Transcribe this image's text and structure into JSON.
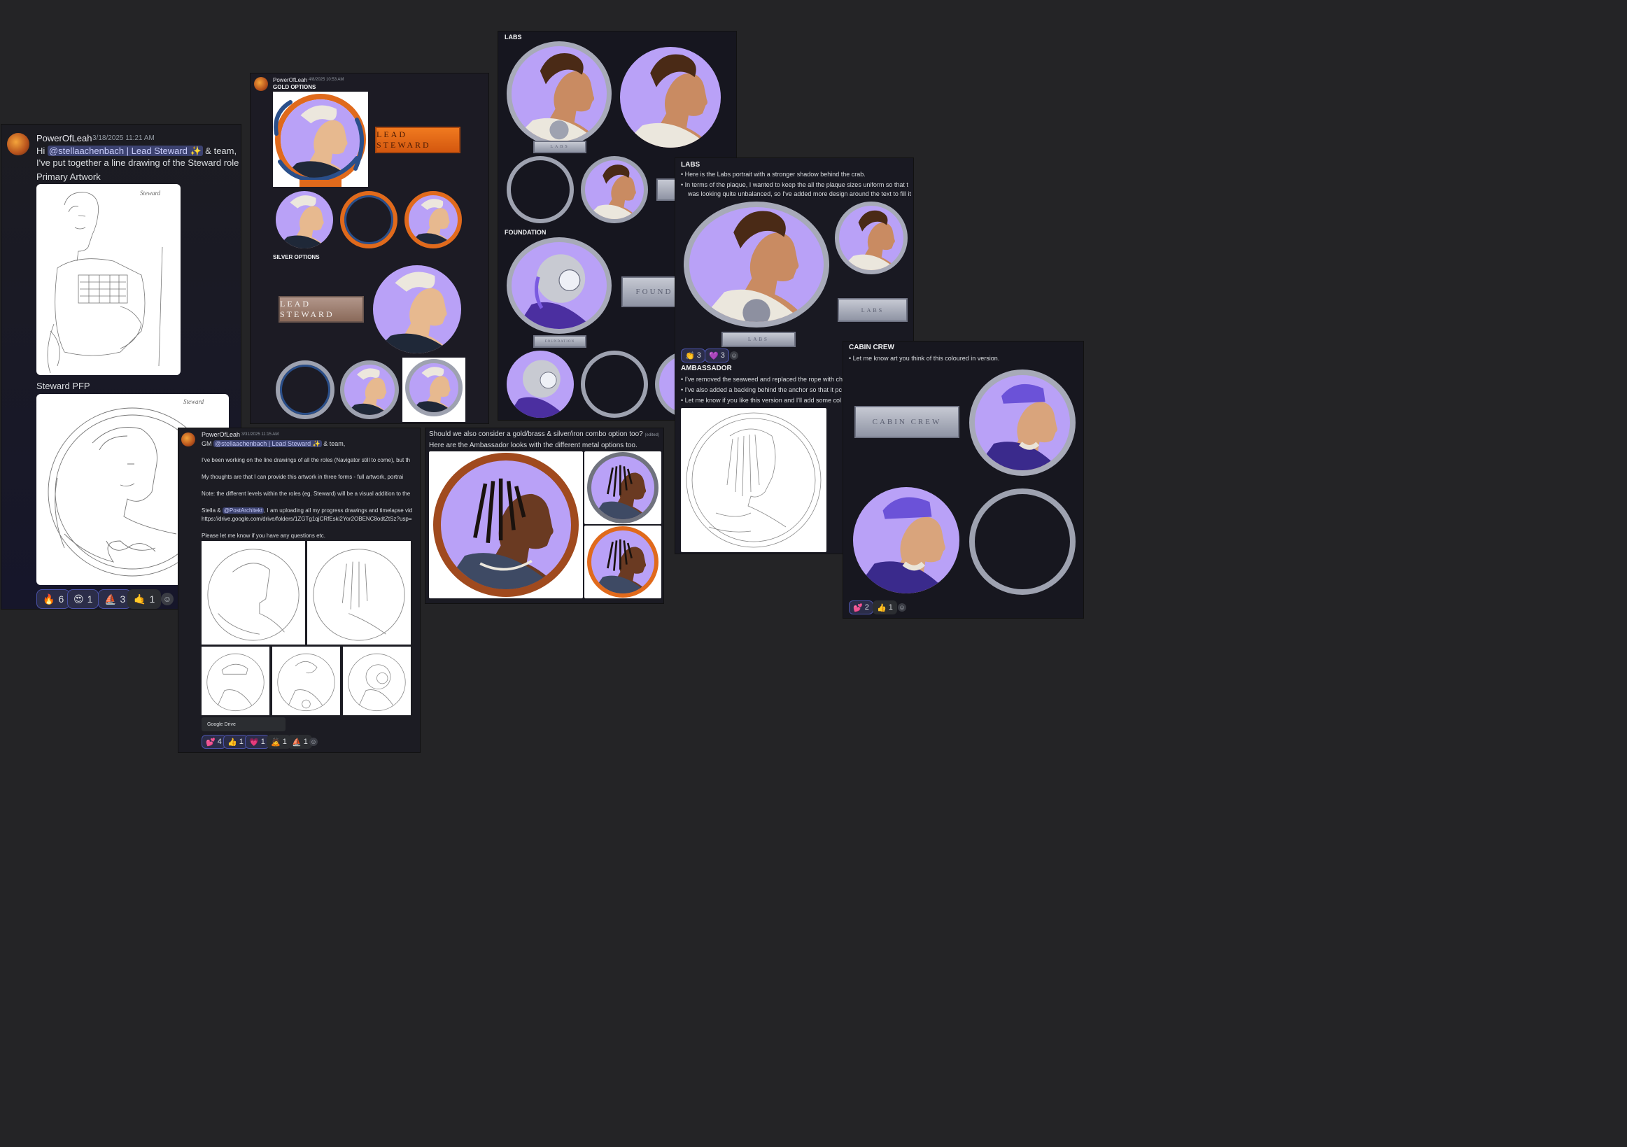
{
  "panel1": {
    "author": "PowerOfLeah",
    "timestamp": "3/18/2025 11:21 AM",
    "greeting": "Hi",
    "mention": "@stellaachenbach | Lead Steward ✨",
    "greeting_tail": " & team,",
    "body": "I've put together a line drawing of the Steward role (Prir",
    "label_primary": "Primary Artwork",
    "label_pfp": "Steward PFP",
    "sketch_signature": "Steward",
    "reactions": [
      {
        "emoji": "🔥",
        "count": "6"
      },
      {
        "emoji": "😍",
        "count": "1"
      },
      {
        "emoji": "⛵",
        "count": "3"
      },
      {
        "emoji": "🤙",
        "count": "1"
      }
    ]
  },
  "panel2": {
    "author": "PowerOfLeah",
    "timestamp": "4/8/2025 10:53 AM",
    "gold_heading": "GOLD OPTIONS",
    "silver_heading": "SILVER OPTIONS",
    "plaque_text": "LEAD STEWARD"
  },
  "panel3": {
    "labs_heading": "LABS",
    "foundation_heading": "FOUNDATION",
    "labs_plaque": "LABS",
    "foundation_plaque": "FOUNDATION",
    "foundation_plaque_partial": "FOUND"
  },
  "panel4": {
    "labs_heading": "LABS",
    "bullets": [
      "Here is the Labs portrait with a stronger shadow behind the crab.",
      "In terms of the plaque, I wanted to keep the all the plaque sizes uniform so that t",
      "was looking quite unbalanced, so I've added more design around the text to fill it"
    ],
    "plaque_small": "LABS",
    "plaque_bottom": "LABS",
    "reactions": [
      {
        "emoji": "👏",
        "count": "3"
      },
      {
        "emoji": "💜",
        "count": "3"
      }
    ],
    "ambassador_heading": "AMBASSADOR",
    "ambassador_bullets": [
      "I've removed the seaweed and replaced the rope with ch",
      "I've also added a backing behind the anchor so that it pc",
      "Let me know if you like this version and I'll add some col"
    ]
  },
  "panel5": {
    "heading": "CABIN CREW",
    "bullet": "Let me know art you think of this coloured in version.",
    "plaque": "CABIN CREW",
    "reactions": [
      {
        "emoji": "💕",
        "count": "2"
      },
      {
        "emoji": "👍",
        "count": "1"
      }
    ]
  },
  "panel6": {
    "author": "PowerOfLeah",
    "timestamp": "3/31/2025 11:15 AM",
    "greeting": "GM",
    "mention": "@stellaachenbach | Lead Steward ✨",
    "greeting_tail": " & team,",
    "p1": "I've been working on the line drawings of all the roles (Navigator still to come), but th",
    "p2": "My thoughts are that I can provide this artwork in three forms - full artwork, portrai",
    "p3": "Note: the different levels within the roles (eg. Steward) will be a visual addition to the",
    "p4_pre": "Stella &",
    "p4_mention": "@PostArchitekt",
    "p4_post": ", I am uploading all my progress drawings and timelapse vid",
    "link": "https://drive.google.com/drive/folders/1ZGTg1qjCRfEski2Yor2OBENC8odtZtSz?usp=",
    "p5": "Please let me know if you have any questions etc.",
    "embed_label": "Google Drive",
    "reactions": [
      {
        "emoji": "💕",
        "count": "4"
      },
      {
        "emoji": "👍",
        "count": "1"
      },
      {
        "emoji": "💗",
        "count": "1"
      },
      {
        "emoji": "🙇",
        "count": "1"
      },
      {
        "emoji": "⛵",
        "count": "1"
      }
    ]
  },
  "panel7": {
    "question": "Should we also consider a gold/brass & silver/iron combo option too?",
    "edited": "(edited)",
    "body": "Here are the Ambassador looks with the different metal options too."
  },
  "colors": {
    "background": "#242426",
    "lavender": "#b9a1f7",
    "gold_ring": "#e06a1c",
    "octopus_blue": "#2a4f8a",
    "silver": "#9ea2b0"
  }
}
